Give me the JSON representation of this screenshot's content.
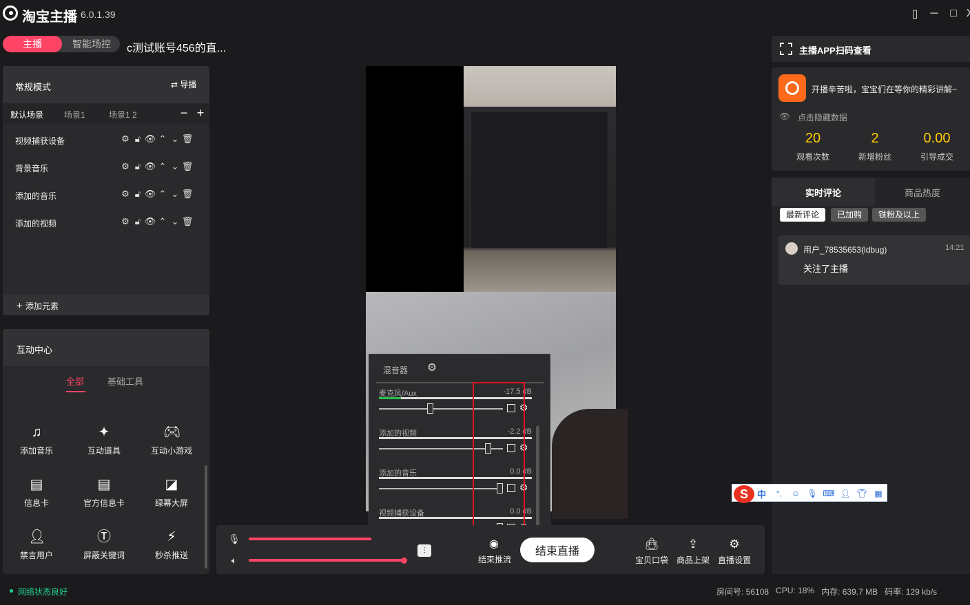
{
  "app": {
    "title": "淘宝主播",
    "version": "6.0.1.39"
  },
  "window": {
    "minimize": "─",
    "maximize": "□",
    "close": "X",
    "extra": "▯"
  },
  "modes": {
    "host": "主播",
    "smart": "智能场控"
  },
  "room_title": "c测试账号456的直...",
  "scene": {
    "mode": "常规模式",
    "guide": "导播",
    "tabs": [
      "默认场景",
      "场景1",
      "场景1 2"
    ],
    "items": [
      "视频捕获设备",
      "背景音乐",
      "添加的音乐",
      "添加的视频"
    ],
    "add_element": "添加元素"
  },
  "interaction": {
    "title": "互动中心",
    "tabs": [
      "全部",
      "基础工具"
    ],
    "tools": [
      "添加音乐",
      "互动道具",
      "互动小游戏",
      "信息卡",
      "官方信息卡",
      "绿幕大屏",
      "禁言用户",
      "屏蔽关键词",
      "秒杀推送"
    ]
  },
  "mixer": {
    "title": "混音器",
    "channels": [
      {
        "name": "麦克风/Aux",
        "db": "-17.5 dB",
        "level": 0.41
      },
      {
        "name": "添加的视频",
        "db": "-2.2 dB",
        "level": 0.9
      },
      {
        "name": "添加的音乐",
        "db": "0.0 dB",
        "level": 1.0
      },
      {
        "name": "视频捕获设备",
        "db": "0.0 dB",
        "level": 1.0
      }
    ]
  },
  "controls": {
    "mic_volume": 0.78,
    "speaker_volume": 1.0,
    "stop_push": "结束推流",
    "end_live": "结束直播",
    "baby_bag": "宝贝口袋",
    "product_list": "商品上架",
    "live_settings": "直播设置"
  },
  "status": {
    "network": "网络状态良好",
    "room_no": "房间号: 56108",
    "cpu": "CPU: 18%",
    "memory": "内存: 639.7 MB",
    "bitrate": "码率: 129 kb/s"
  },
  "right": {
    "qr_text": "主播APP扫码查看",
    "notice": "开播辛苦啦，宝宝们在等你的精彩讲解~",
    "hide_data": "点击隐藏数据",
    "stats": [
      {
        "value": "20",
        "label": "观看次数"
      },
      {
        "value": "2",
        "label": "新增粉丝"
      },
      {
        "value": "0.00",
        "label": "引导成交"
      }
    ],
    "comment_tabs": [
      "实时评论",
      "商品热度"
    ],
    "filters": [
      "最新评论",
      "已加购",
      "铁粉及以上"
    ],
    "comment": {
      "user": "用户_78535653(ldbug)",
      "time": "14:21",
      "text": "关注了主播"
    }
  },
  "ime": {
    "label": "中"
  },
  "colors": {
    "accent": "#ff4466",
    "stat": "#ffcc00",
    "network_ok": "#1fd18a",
    "highlight_box": "#e0141e"
  }
}
